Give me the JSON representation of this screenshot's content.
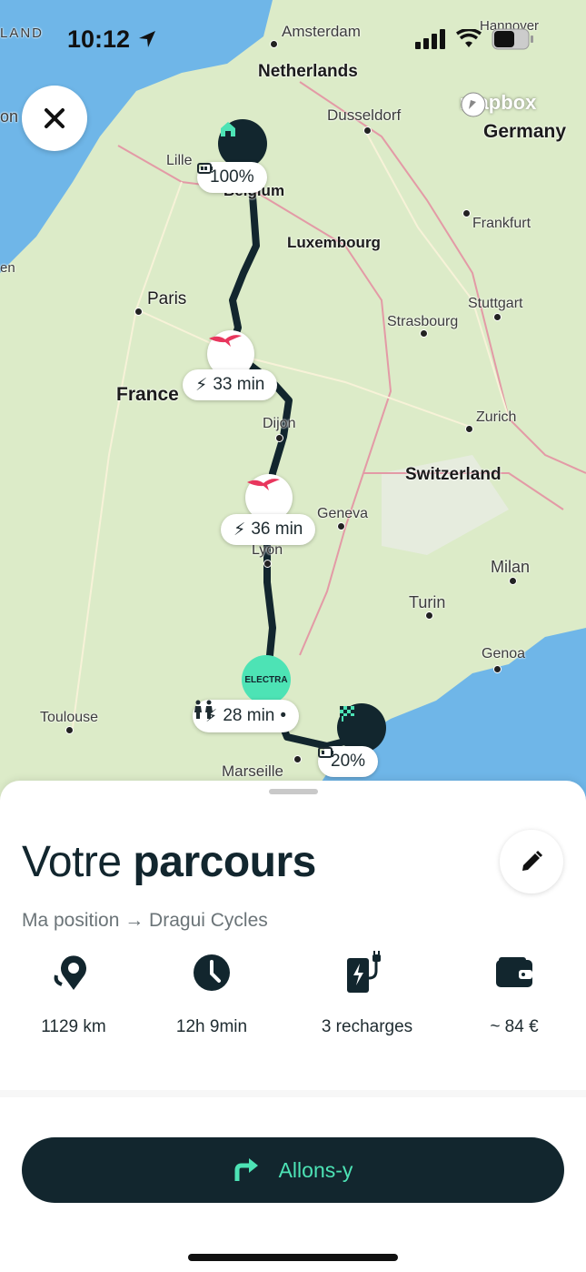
{
  "status_bar": {
    "time": "10:12"
  },
  "map": {
    "attribution": "mapbox",
    "countries": [
      "Netherlands",
      "Germany",
      "Luxembourg",
      "France",
      "Switzerland",
      "Belgium"
    ],
    "cities": [
      "Amsterdam",
      "Hannover",
      "Dusseldorf",
      "Lille",
      "Frankfurt",
      "Paris",
      "Stuttgart",
      "Strasbourg",
      "Dijon",
      "Zurich",
      "Geneva",
      "Lyon",
      "Milan",
      "Turin",
      "Genoa",
      "Toulouse",
      "Marseille"
    ],
    "partial_labels": [
      "LAND",
      "on",
      "en"
    ],
    "start": {
      "battery": "100%"
    },
    "stops": [
      {
        "duration": "33 min",
        "operator_icon": "ionity-bird-icon"
      },
      {
        "duration": "36 min",
        "operator_icon": "ionity-bird-icon"
      },
      {
        "duration": "28 min",
        "operator": "ELECTRA",
        "amenity_icon": "restroom-icon"
      }
    ],
    "end": {
      "battery": "20%"
    }
  },
  "sheet": {
    "title_light": "Votre",
    "title_bold": "parcours",
    "route": "Ma position → Dragui Cycles",
    "stats": [
      {
        "icon": "distance-pin-icon",
        "label": "1129 km"
      },
      {
        "icon": "clock-icon",
        "label": "12h 9min"
      },
      {
        "icon": "charger-icon",
        "label": "3 recharges"
      },
      {
        "icon": "wallet-icon",
        "label": "~ 84 €"
      }
    ],
    "go_label": "Allons-y"
  },
  "colors": {
    "dark": "#12262e",
    "accent": "#4de3b5",
    "ionity": "#e8365d"
  }
}
